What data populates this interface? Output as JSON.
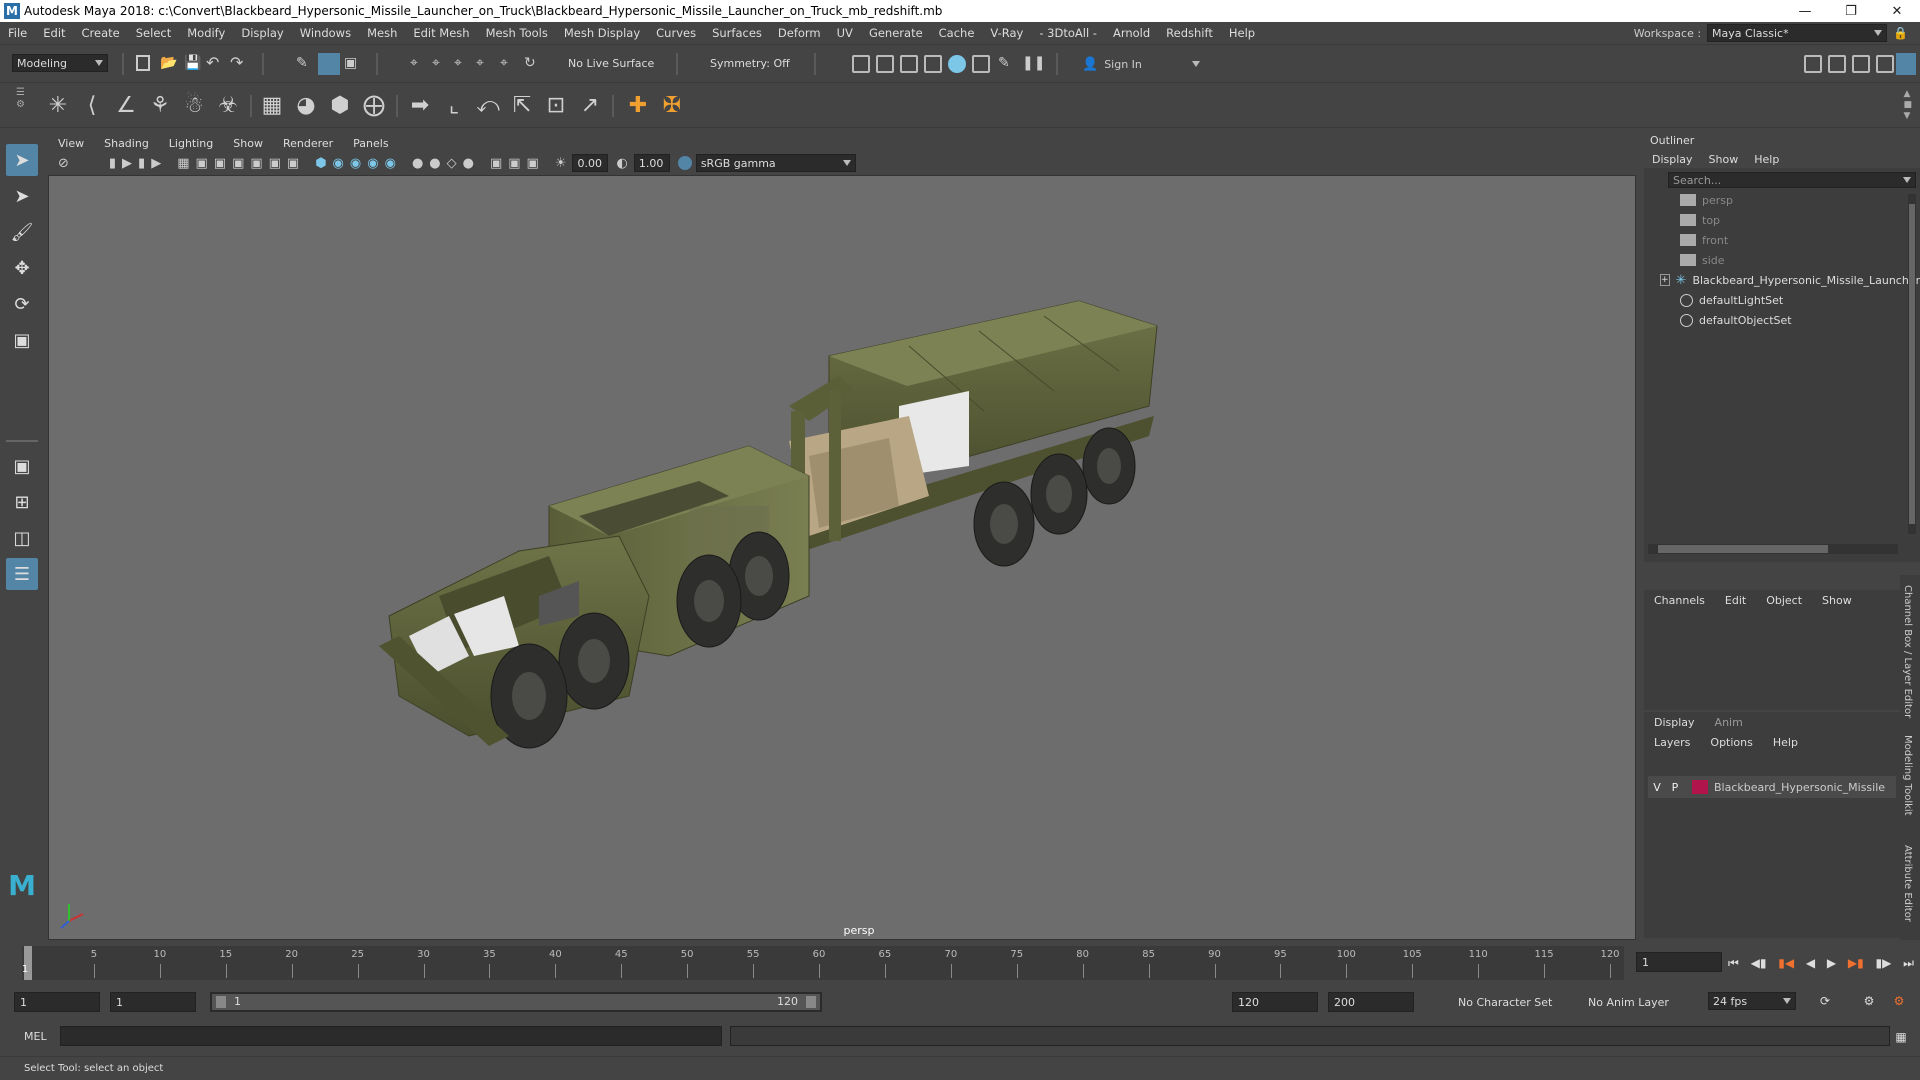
{
  "window": {
    "title": "Autodesk Maya 2018: c:\\Convert\\Blackbeard_Hypersonic_Missile_Launcher_on_Truck\\Blackbeard_Hypersonic_Missile_Launcher_on_Truck_mb_redshift.mb",
    "logo": "M"
  },
  "menubar": {
    "items": [
      "File",
      "Edit",
      "Create",
      "Select",
      "Modify",
      "Display",
      "Windows",
      "Mesh",
      "Edit Mesh",
      "Mesh Tools",
      "Mesh Display",
      "Curves",
      "Surfaces",
      "Deform",
      "UV",
      "Generate",
      "Cache",
      "V-Ray",
      "- 3DtoAll -",
      "Arnold",
      "Redshift",
      "Help"
    ],
    "workspace_label": "Workspace :",
    "workspace_value": "Maya Classic*"
  },
  "statusline": {
    "mode": "Modeling",
    "live_surface": "No Live Surface",
    "symmetry": "Symmetry: Off",
    "sign_in": "Sign In"
  },
  "viewport": {
    "menu": [
      "View",
      "Shading",
      "Lighting",
      "Show",
      "Renderer",
      "Panels"
    ],
    "exposure": "0.00",
    "gamma": "1.00",
    "color_space": "sRGB gamma",
    "camera_label": "persp"
  },
  "outliner": {
    "title": "Outliner",
    "menu": [
      "Display",
      "Show",
      "Help"
    ],
    "search_placeholder": "Search...",
    "items": [
      {
        "label": "persp",
        "dim": true,
        "icon": "camera-icon"
      },
      {
        "label": "top",
        "dim": true,
        "icon": "camera-icon"
      },
      {
        "label": "front",
        "dim": true,
        "icon": "camera-icon"
      },
      {
        "label": "side",
        "dim": true,
        "icon": "camera-icon"
      },
      {
        "label": "Blackbeard_Hypersonic_Missile_Launcher",
        "dim": false,
        "icon": "group-icon"
      },
      {
        "label": "defaultLightSet",
        "dim": false,
        "icon": "set-icon"
      },
      {
        "label": "defaultObjectSet",
        "dim": false,
        "icon": "set-icon"
      }
    ]
  },
  "channelbox": {
    "menu": [
      "Channels",
      "Edit",
      "Object",
      "Show"
    ]
  },
  "layereditor": {
    "tabs": [
      "Display",
      "Anim"
    ],
    "menu": [
      "Layers",
      "Options",
      "Help"
    ],
    "layer": {
      "v": "V",
      "p": "P",
      "name": "Blackbeard_Hypersonic_Missile",
      "color": "#b0144a"
    }
  },
  "sidetabs": [
    "Channel Box / Layer Editor",
    "Modeling Toolkit",
    "Attribute Editor"
  ],
  "timeslider": {
    "ticks": [
      "5",
      "10",
      "15",
      "20",
      "25",
      "30",
      "35",
      "40",
      "45",
      "50",
      "55",
      "60",
      "65",
      "70",
      "75",
      "80",
      "85",
      "90",
      "95",
      "100",
      "105",
      "110",
      "115",
      "120"
    ],
    "start_marker": "1",
    "current_frame": "1"
  },
  "rangeslider": {
    "start": "1",
    "playback_start": "1",
    "range_start_label": "1",
    "range_end_label": "120",
    "playback_end": "120",
    "end": "200",
    "character_set": "No Character Set",
    "anim_layer": "No Anim Layer",
    "fps": "24 fps"
  },
  "cmdline": {
    "label": "MEL"
  },
  "helpline": {
    "text": "Select Tool: select an object"
  }
}
